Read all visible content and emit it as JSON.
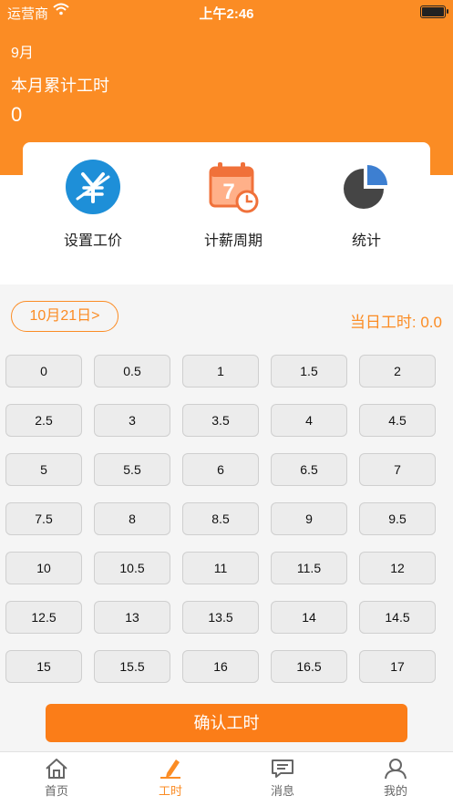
{
  "status_bar": {
    "carrier": "运营商",
    "time": "上午2:46"
  },
  "header": {
    "month": "9月",
    "total_label": "本月累计工时",
    "total_value": "0"
  },
  "features": [
    {
      "label": "设置工价",
      "icon": "yen-icon"
    },
    {
      "label": "计薪周期",
      "icon": "calendar-icon",
      "day": "7"
    },
    {
      "label": "统计",
      "icon": "pie-chart-icon"
    }
  ],
  "date_selector": {
    "label": "10月21日>"
  },
  "day_hours": "当日工时: 0.0",
  "hours_options": [
    "0",
    "0.5",
    "1",
    "1.5",
    "2",
    "2.5",
    "3",
    "3.5",
    "4",
    "4.5",
    "5",
    "5.5",
    "6",
    "6.5",
    "7",
    "7.5",
    "8",
    "8.5",
    "9",
    "9.5",
    "10",
    "10.5",
    "11",
    "11.5",
    "12",
    "12.5",
    "13",
    "13.5",
    "14",
    "14.5",
    "15",
    "15.5",
    "16",
    "16.5",
    "17"
  ],
  "confirm_label": "确认工时",
  "tabs": [
    {
      "label": "首页",
      "icon": "home-icon"
    },
    {
      "label": "工时",
      "icon": "edit-icon",
      "active": true
    },
    {
      "label": "消息",
      "icon": "message-icon"
    },
    {
      "label": "我的",
      "icon": "user-icon"
    }
  ],
  "colors": {
    "accent": "#fb8c24",
    "button_bg": "#ececec",
    "blue": "#1e8fd8",
    "dark": "#444444"
  }
}
